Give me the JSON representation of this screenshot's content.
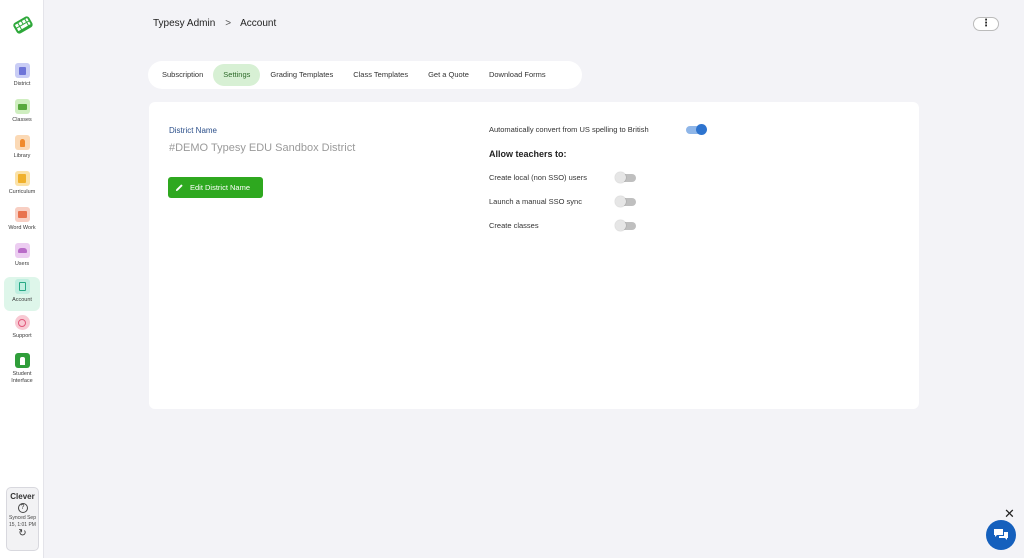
{
  "breadcrumb": {
    "root": "Typesy Admin",
    "separator": ">",
    "current": "Account"
  },
  "menu": {
    "icon": "more-vertical-icon",
    "label": "⋮"
  },
  "sidebar": {
    "items": [
      {
        "label": "District",
        "icon": "district-icon",
        "color": "#c9cdf5"
      },
      {
        "label": "Classes",
        "icon": "classes-icon",
        "color": "#cfeec0"
      },
      {
        "label": "Library",
        "icon": "library-icon",
        "color": "#fbd9b5"
      },
      {
        "label": "Curriculum",
        "icon": "curriculum-icon",
        "color": "#fbe2a8"
      },
      {
        "label": "Word Work",
        "icon": "word-work-icon",
        "color": "#f8cfc3"
      },
      {
        "label": "Users",
        "icon": "users-icon",
        "color": "#eccdf1"
      },
      {
        "label": "Account",
        "icon": "account-icon",
        "color": "#bfeee0",
        "active": true
      },
      {
        "label": "Support",
        "icon": "support-icon",
        "color": "#f8c9d3"
      },
      {
        "label": "Student Interface",
        "icon": "student-interface-icon",
        "color": "#2f9e3a"
      }
    ],
    "clever": {
      "title": "Clever",
      "help": "?",
      "synced": "Synced Sep 15, 1:01 PM",
      "refresh": "↻"
    }
  },
  "tabs": [
    {
      "label": "Subscription"
    },
    {
      "label": "Settings",
      "active": true
    },
    {
      "label": "Grading Templates"
    },
    {
      "label": "Class Templates"
    },
    {
      "label": "Get a Quote"
    },
    {
      "label": "Download Forms"
    }
  ],
  "district": {
    "label": "District Name",
    "value": "#DEMO Typesy EDU Sandbox District",
    "edit_button": "Edit District Name"
  },
  "settings": {
    "auto_convert": {
      "label": "Automatically convert from US spelling to British",
      "enabled": true
    },
    "allow_heading": "Allow teachers to:",
    "permissions": [
      {
        "label": "Create local (non SSO) users",
        "enabled": false
      },
      {
        "label": "Launch a manual SSO sync",
        "enabled": false
      },
      {
        "label": "Create classes",
        "enabled": false
      }
    ]
  },
  "chat": {
    "close": "✕",
    "icon": "chat-icon"
  },
  "colors": {
    "accent_green": "#2ea81f",
    "toggle_blue": "#2e74cf",
    "tab_active": "#d7f0d4"
  }
}
